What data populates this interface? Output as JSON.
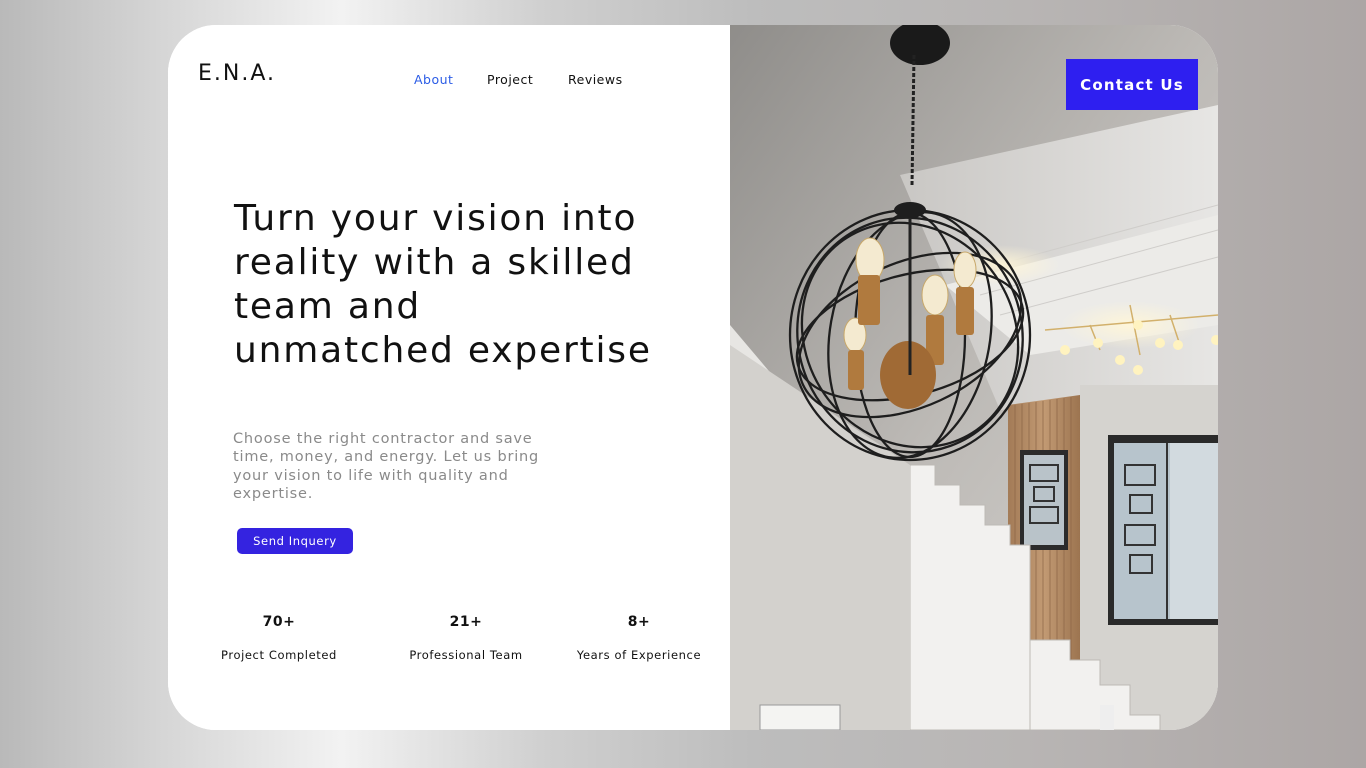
{
  "brand": {
    "logo": "E.N.A."
  },
  "nav": {
    "about": "About",
    "project": "Project",
    "reviews": "Reviews"
  },
  "hero": {
    "headline": "Turn your vision into reality with a skilled team and unmatched expertise",
    "subtext": "Choose the right contractor and save time, money, and energy. Let us bring your vision to life with quality and expertise.",
    "cta_label": "Send Inquery"
  },
  "stats": [
    {
      "value": "70+",
      "label": "Project Completed"
    },
    {
      "value": "21+",
      "label": "Professional Team"
    },
    {
      "value": "8+",
      "label": "Years of Experience"
    }
  ],
  "header": {
    "contact_label": "Contact Us"
  },
  "colors": {
    "accent": "#3423e0",
    "contact_bg": "#2e1ff0",
    "nav_active": "#2b5ce6",
    "text": "#111111",
    "muted": "#8a8a8a"
  },
  "image": {
    "subject": "chandelier-staircase-photo"
  }
}
